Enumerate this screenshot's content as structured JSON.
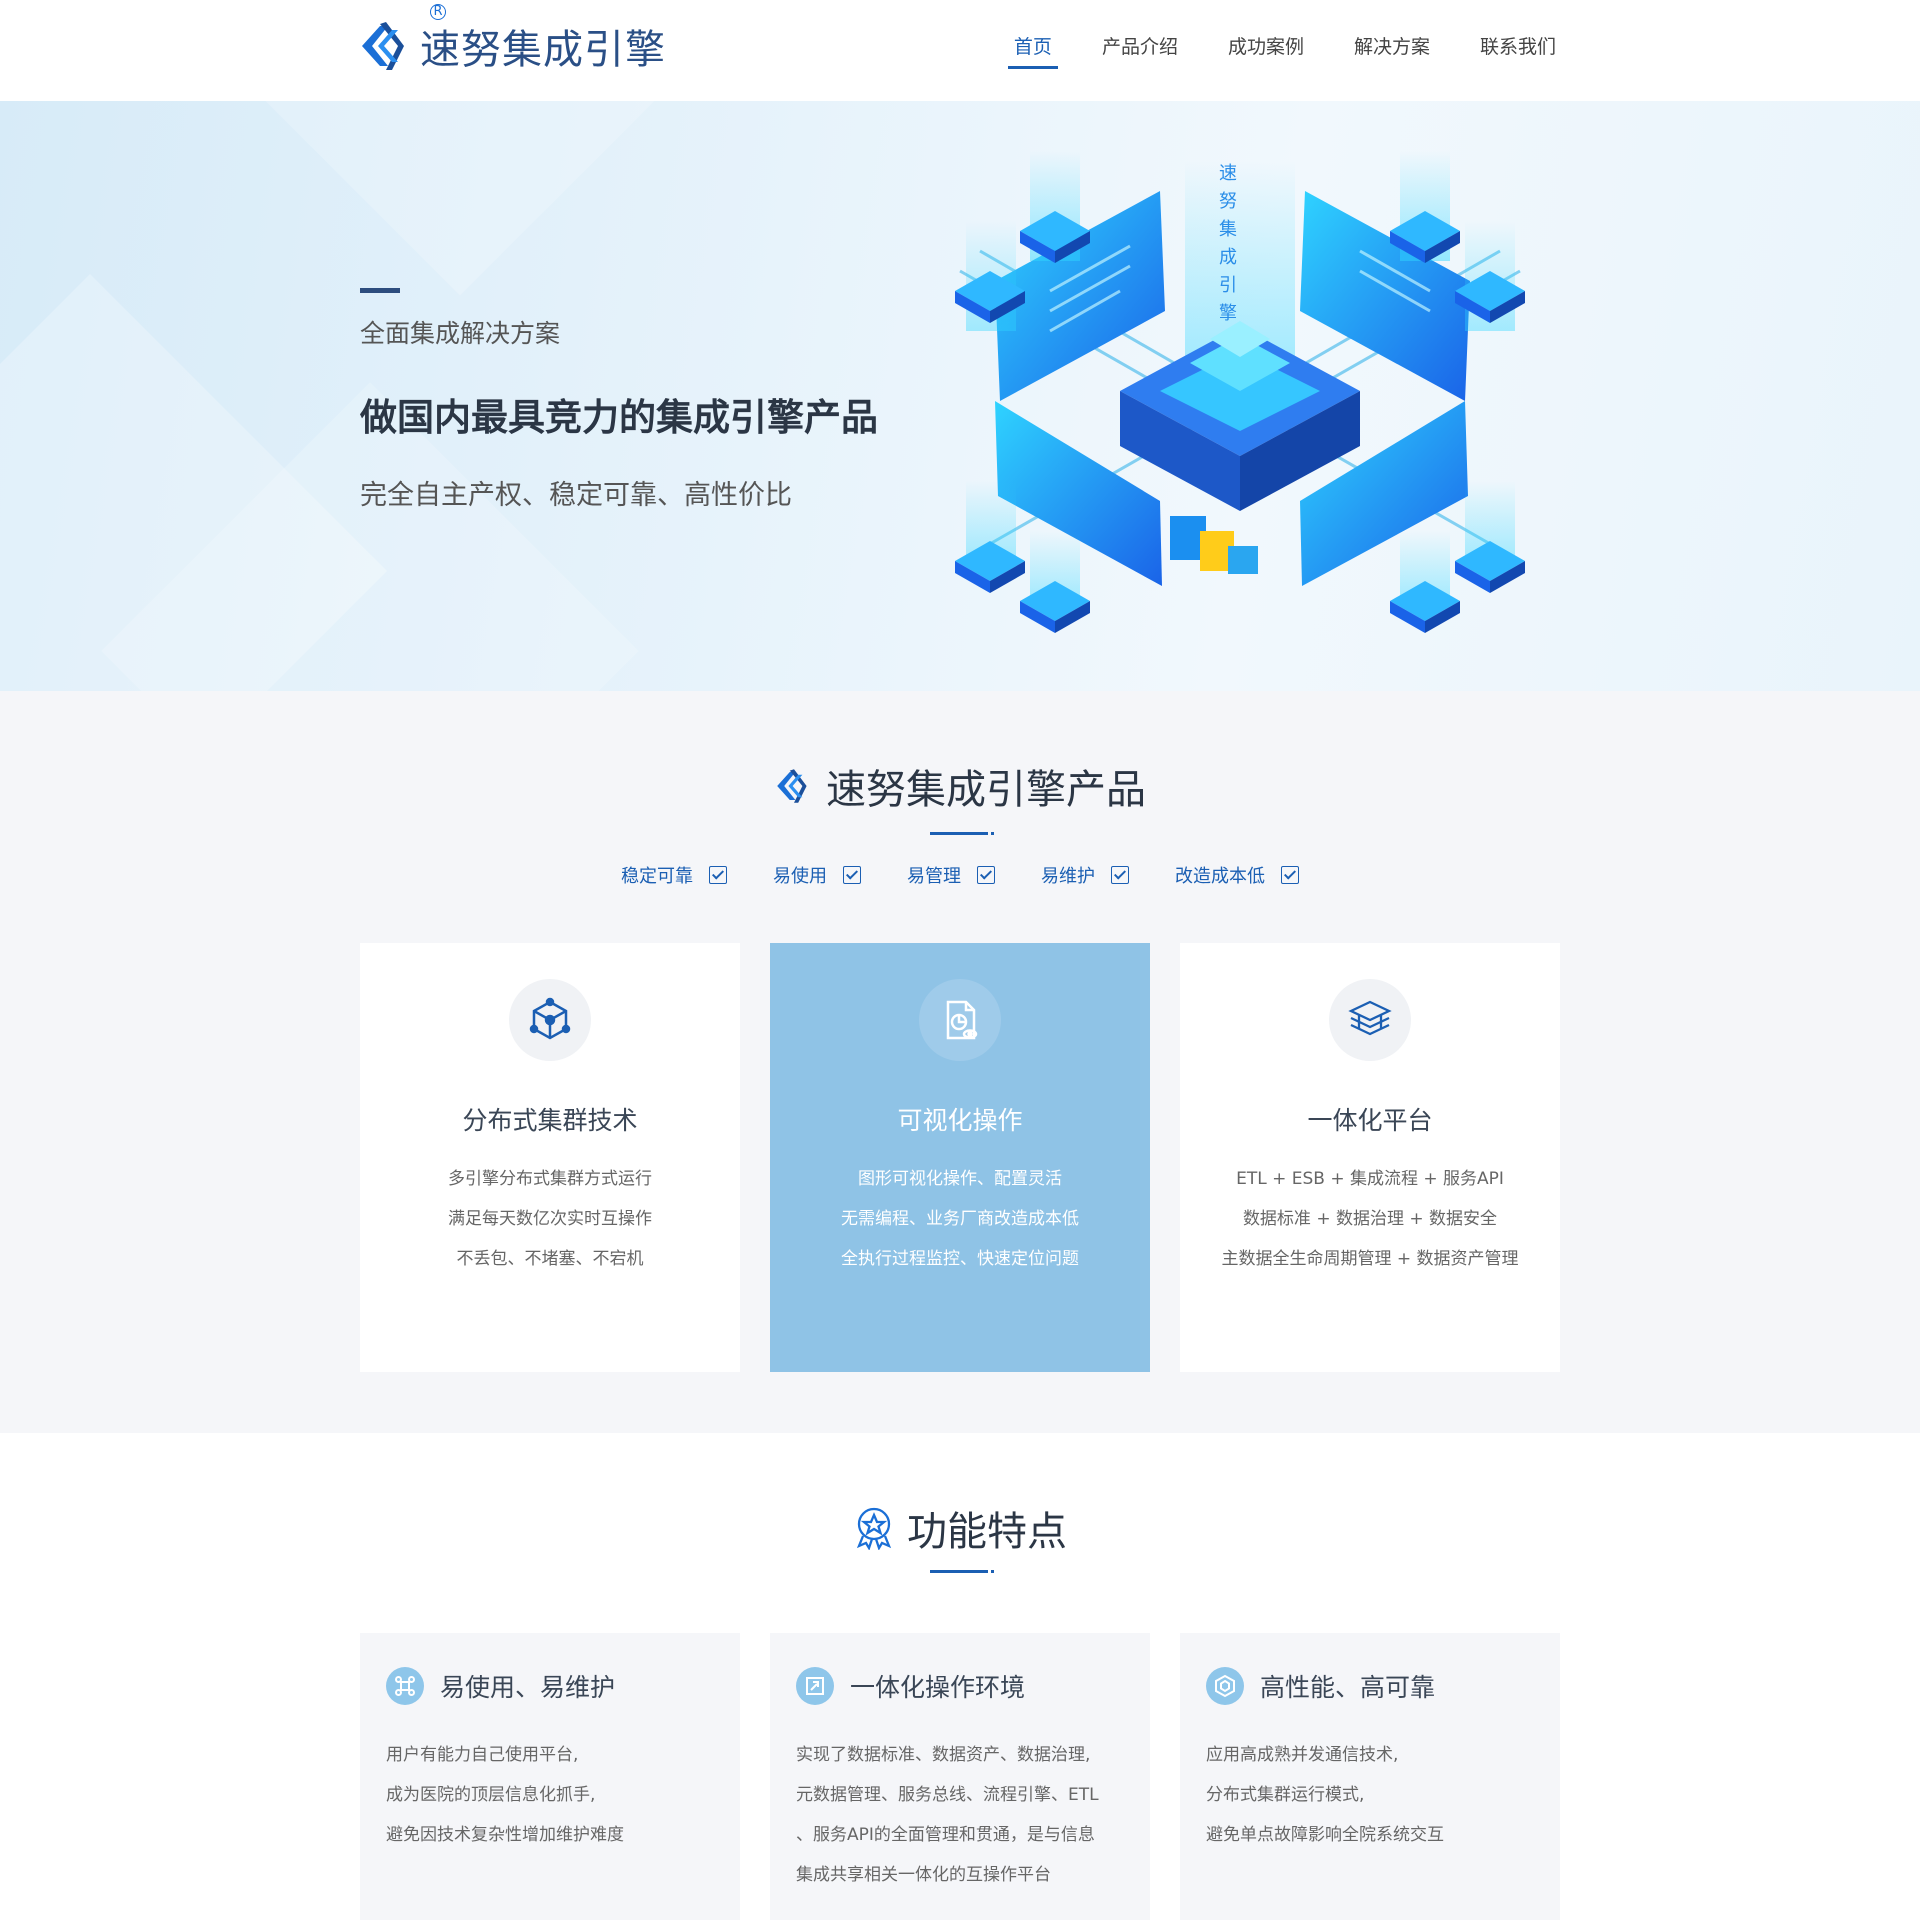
{
  "header": {
    "logo_text": "速努集成引擎",
    "logo_reg": "R",
    "nav": [
      "首页",
      "产品介绍",
      "成功案例",
      "解决方案",
      "联系我们"
    ]
  },
  "hero": {
    "subtitle": "全面集成解决方案",
    "title": "做国内最具竞力的集成引擎产品",
    "desc": "完全自主产权、稳定可靠、高性价比",
    "art_label": "速努集成引擎"
  },
  "products": {
    "title": "速努集成引擎产品",
    "features": [
      "稳定可靠",
      "易使用",
      "易管理",
      "易维护",
      "改造成本低"
    ],
    "cards": [
      {
        "icon": "cube-network-icon",
        "title": "分布式集群技术",
        "lines": [
          "多引擎分布式集群方式运行",
          "满足每天数亿次实时互操作",
          "不丢包、不堵塞、不宕机"
        ]
      },
      {
        "icon": "visual-document-icon",
        "title": "可视化操作",
        "lines": [
          "图形可视化操作、配置灵活",
          "无需编程、业务厂商改造成本低",
          "全执行过程监控、快速定位问题"
        ]
      },
      {
        "icon": "layers-icon",
        "title": "一体化平台",
        "lines": [
          "ETL + ESB + 集成流程 + 服务API",
          "数据标准 + 数据治理 + 数据安全",
          "主数据全生命周期管理 + 数据资产管理"
        ]
      }
    ]
  },
  "functions": {
    "title": "功能特点",
    "cards": [
      {
        "icon": "command-icon",
        "title": "易使用、易维护",
        "lines": [
          "用户有能力自己使用平台,",
          "成为医院的顶层信息化抓手,",
          "避免因技术复杂性增加维护难度"
        ]
      },
      {
        "icon": "integration-window-icon",
        "title": "一体化操作环境",
        "lines": [
          "实现了数据标准、数据资产、数据治理,",
          "元数据管理、服务总线、流程引擎、ETL",
          "、服务API的全面管理和贯通，是与信息",
          "集成共享相关一体化的互操作平台"
        ]
      },
      {
        "icon": "hexagon-shield-icon",
        "title": "高性能、高可靠",
        "lines": [
          "应用高成熟并发通信技术,",
          "分布式集群运行模式,",
          "避免单点故障影响全院系统交互"
        ]
      }
    ]
  },
  "colors": {
    "primary": "#1b5fb3",
    "highlight_card": "#8fc3e6",
    "title": "#2b3645"
  }
}
